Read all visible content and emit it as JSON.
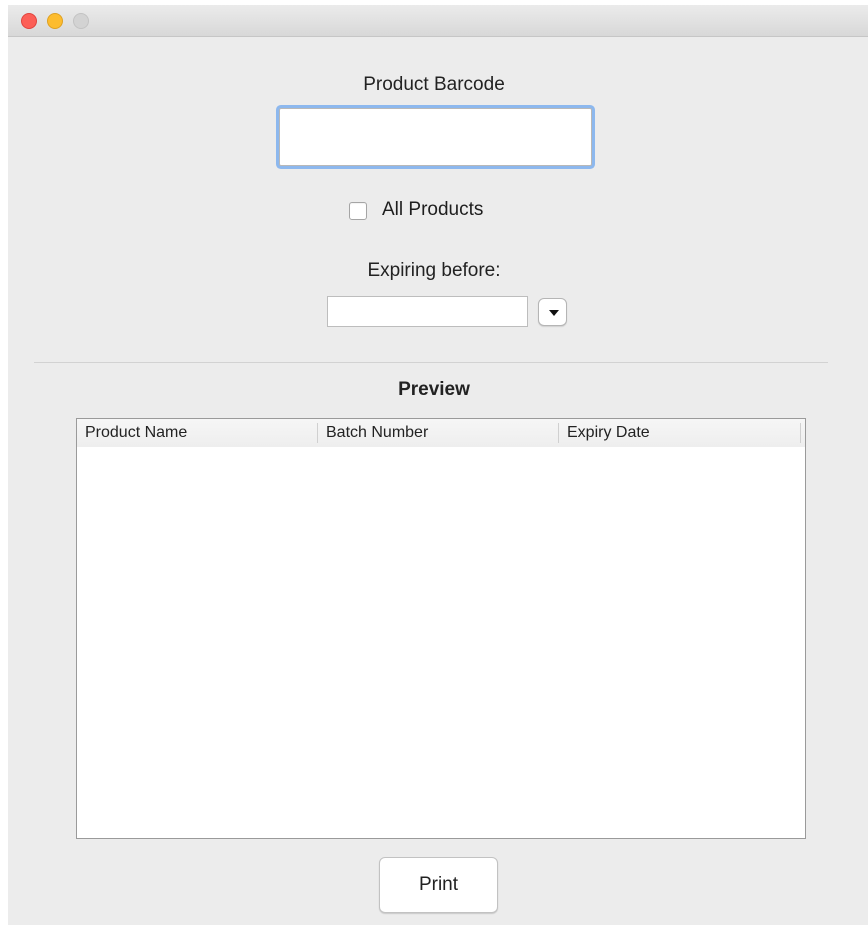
{
  "window": {
    "controls": {
      "close_icon": "close-icon",
      "minimize_icon": "minimize-icon",
      "zoom_icon": "zoom-icon",
      "colors": {
        "close": "#fc5f57",
        "minimize": "#fdbc2e",
        "zoom": "#d3d3d3"
      }
    }
  },
  "form": {
    "barcode_label": "Product Barcode",
    "barcode_value": "",
    "all_products_label": "All Products",
    "all_products_checked": false,
    "expiring_label": "Expiring before:",
    "expiring_value": "",
    "dropdown_icon": "caret-down-icon"
  },
  "preview": {
    "title": "Preview",
    "columns": [
      "Product Name",
      "Batch Number",
      "Expiry Date"
    ],
    "rows": []
  },
  "actions": {
    "print_label": "Print"
  },
  "colors": {
    "focus_ring": "#8db8ee",
    "window_bg": "#ececec"
  }
}
